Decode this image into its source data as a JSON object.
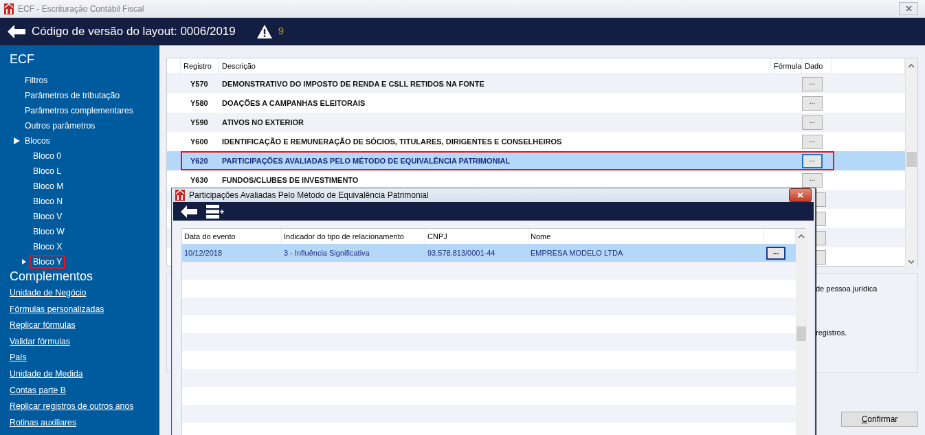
{
  "window": {
    "title": "ECF - Escrituração Contábil Fiscal"
  },
  "header": {
    "title": "Código de versão do layout: 0006/2019",
    "warning_count": "9"
  },
  "sidebar": {
    "title": "ECF",
    "items": [
      {
        "label": "Filtros"
      },
      {
        "label": "Parâmetros de tributação"
      },
      {
        "label": "Parâmetros complementares"
      },
      {
        "label": "Outros parâmetros"
      },
      {
        "label": "Blocos",
        "expanded": true,
        "children": [
          {
            "label": "Bloco 0"
          },
          {
            "label": "Bloco L"
          },
          {
            "label": "Bloco M"
          },
          {
            "label": "Bloco N"
          },
          {
            "label": "Bloco V"
          },
          {
            "label": "Bloco W"
          },
          {
            "label": "Bloco X"
          },
          {
            "label": "Bloco Y",
            "expanded": false,
            "highlighted": true
          }
        ]
      }
    ],
    "section_title": "Complementos",
    "links": [
      "Unidade de Negócio",
      "Fórmulas personalizadas",
      "Replicar fórmulas",
      "Validar fórmulas",
      "País",
      "Unidade de Medida",
      "Contas parte B",
      "Replicar registros de outros anos",
      "Rotinas auxiliares"
    ]
  },
  "table": {
    "columns": [
      "Registro",
      "Descrição",
      "Fórmula",
      "Dado"
    ],
    "rows": [
      {
        "registro": "Y570",
        "descricao": "DEMONSTRATIVO DO IMPOSTO DE RENDA E CSLL RETIDOS NA FONTE",
        "dado": "...",
        "selected": false,
        "highlighted": false
      },
      {
        "registro": "Y580",
        "descricao": "DOAÇÕES A CAMPANHAS ELEITORAIS",
        "dado": "...",
        "selected": false,
        "highlighted": false
      },
      {
        "registro": "Y590",
        "descricao": "ATIVOS NO EXTERIOR",
        "dado": "...",
        "selected": false,
        "highlighted": false
      },
      {
        "registro": "Y600",
        "descricao": "IDENTIFICAÇÃO E REMUNERAÇÃO DE SÓCIOS, TITULARES, DIRIGENTES E CONSELHEIROS",
        "dado": "...",
        "selected": false,
        "highlighted": false
      },
      {
        "registro": "Y620",
        "descricao": "PARTICIPAÇÕES AVALIADAS PELO MÉTODO DE EQUIVALÊNCIA PATRIMONIAL",
        "dado": "...",
        "selected": true,
        "highlighted": true
      },
      {
        "registro": "Y630",
        "descricao": "FUNDOS/CLUBES DE INVESTIMENTO",
        "dado": "...",
        "selected": false,
        "highlighted": false
      }
    ]
  },
  "info_panel": {
    "lines": [
      "de pessoa jurídica",
      "registros."
    ]
  },
  "confirm_button": "Confirmar",
  "dialog": {
    "title": "Participações Avaliadas Pelo Método de Equivalência Patrimonial",
    "columns": [
      "Data do evento",
      "Indicador do tipo de relacionamento",
      "CNPJ",
      "Nome"
    ],
    "rows": [
      {
        "cells": [
          "10/12/2018",
          "3 - Influência Significativa",
          "93.578.813/0001-44",
          "EMPRESA MODELO LTDA"
        ],
        "action": "...",
        "selected": true
      }
    ]
  }
}
